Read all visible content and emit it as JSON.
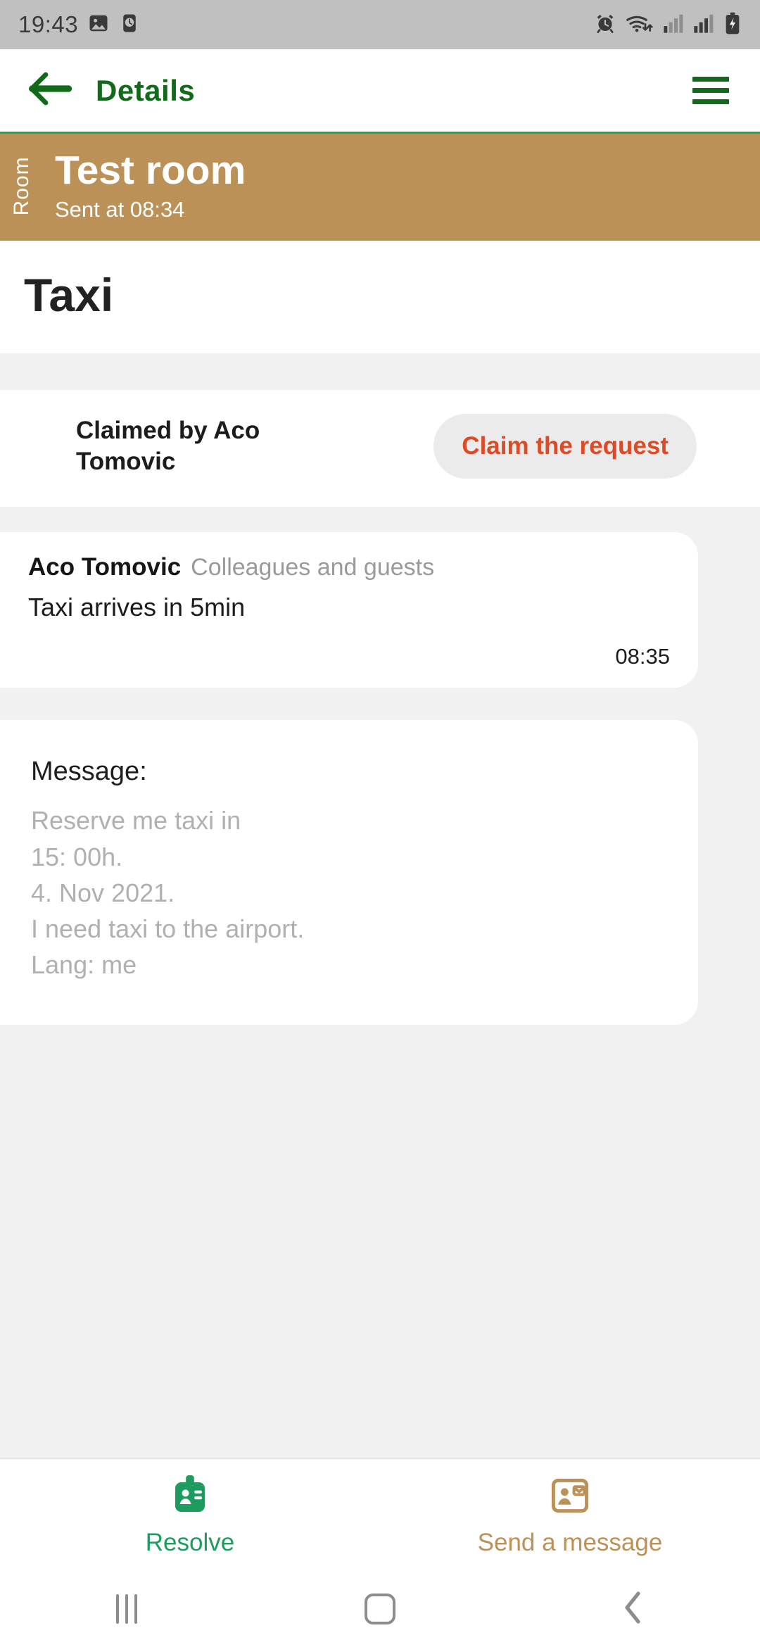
{
  "status_bar": {
    "time": "19:43",
    "left_icons": [
      "image-icon",
      "clock-icon"
    ],
    "right_icons": [
      "alarm-icon",
      "wifi-icon",
      "signal-1-icon",
      "signal-2-icon",
      "battery-charging-icon"
    ]
  },
  "header": {
    "title": "Details",
    "back_icon": "back-arrow-icon",
    "menu_icon": "hamburger-menu-icon"
  },
  "room_banner": {
    "side_label": "Room",
    "name": "Test room",
    "sent_at": "Sent at 08:34",
    "background_color": "#bc9157"
  },
  "request": {
    "title": "Taxi"
  },
  "claim": {
    "claimed_by": "Claimed by Aco Tomovic",
    "button_label": "Claim the request",
    "button_text_color": "#dc4b26",
    "button_background_color": "#ebebeb"
  },
  "message_card": {
    "author": "Aco Tomovic",
    "audience": "Colleagues and guests",
    "text": "Taxi arrives in 5min",
    "time": "08:35"
  },
  "detail_card": {
    "label": "Message:",
    "lines": [
      "Reserve me taxi in",
      "15: 00h.",
      "4. Nov 2021.",
      "I need taxi to the airport.",
      " Lang: me"
    ]
  },
  "actions": {
    "resolve": {
      "label": "Resolve",
      "icon": "id-badge-icon",
      "color": "#1e9b5e"
    },
    "send_message": {
      "label": "Send a message",
      "icon": "contact-card-icon",
      "color": "#bc9157"
    }
  },
  "nav_bar": {
    "recents_icon": "recents-icon",
    "home_icon": "home-icon",
    "back_icon": "nav-back-icon"
  }
}
